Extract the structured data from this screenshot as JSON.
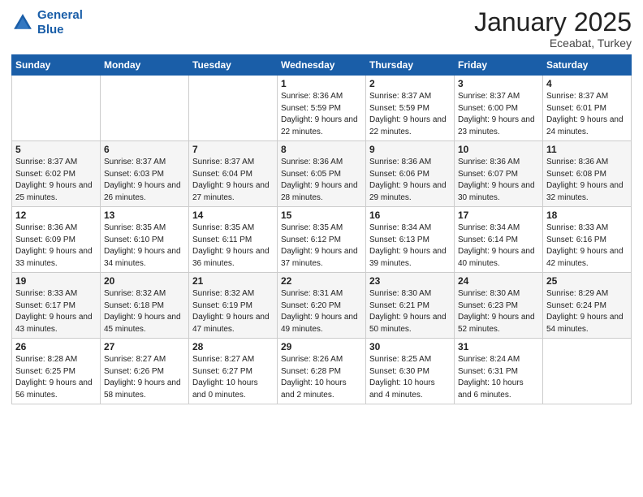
{
  "header": {
    "logo_line1": "General",
    "logo_line2": "Blue",
    "month": "January 2025",
    "location": "Eceabat, Turkey"
  },
  "weekdays": [
    "Sunday",
    "Monday",
    "Tuesday",
    "Wednesday",
    "Thursday",
    "Friday",
    "Saturday"
  ],
  "weeks": [
    [
      {
        "day": "",
        "info": ""
      },
      {
        "day": "",
        "info": ""
      },
      {
        "day": "",
        "info": ""
      },
      {
        "day": "1",
        "info": "Sunrise: 8:36 AM\nSunset: 5:59 PM\nDaylight: 9 hours and 22 minutes."
      },
      {
        "day": "2",
        "info": "Sunrise: 8:37 AM\nSunset: 5:59 PM\nDaylight: 9 hours and 22 minutes."
      },
      {
        "day": "3",
        "info": "Sunrise: 8:37 AM\nSunset: 6:00 PM\nDaylight: 9 hours and 23 minutes."
      },
      {
        "day": "4",
        "info": "Sunrise: 8:37 AM\nSunset: 6:01 PM\nDaylight: 9 hours and 24 minutes."
      }
    ],
    [
      {
        "day": "5",
        "info": "Sunrise: 8:37 AM\nSunset: 6:02 PM\nDaylight: 9 hours and 25 minutes."
      },
      {
        "day": "6",
        "info": "Sunrise: 8:37 AM\nSunset: 6:03 PM\nDaylight: 9 hours and 26 minutes."
      },
      {
        "day": "7",
        "info": "Sunrise: 8:37 AM\nSunset: 6:04 PM\nDaylight: 9 hours and 27 minutes."
      },
      {
        "day": "8",
        "info": "Sunrise: 8:36 AM\nSunset: 6:05 PM\nDaylight: 9 hours and 28 minutes."
      },
      {
        "day": "9",
        "info": "Sunrise: 8:36 AM\nSunset: 6:06 PM\nDaylight: 9 hours and 29 minutes."
      },
      {
        "day": "10",
        "info": "Sunrise: 8:36 AM\nSunset: 6:07 PM\nDaylight: 9 hours and 30 minutes."
      },
      {
        "day": "11",
        "info": "Sunrise: 8:36 AM\nSunset: 6:08 PM\nDaylight: 9 hours and 32 minutes."
      }
    ],
    [
      {
        "day": "12",
        "info": "Sunrise: 8:36 AM\nSunset: 6:09 PM\nDaylight: 9 hours and 33 minutes."
      },
      {
        "day": "13",
        "info": "Sunrise: 8:35 AM\nSunset: 6:10 PM\nDaylight: 9 hours and 34 minutes."
      },
      {
        "day": "14",
        "info": "Sunrise: 8:35 AM\nSunset: 6:11 PM\nDaylight: 9 hours and 36 minutes."
      },
      {
        "day": "15",
        "info": "Sunrise: 8:35 AM\nSunset: 6:12 PM\nDaylight: 9 hours and 37 minutes."
      },
      {
        "day": "16",
        "info": "Sunrise: 8:34 AM\nSunset: 6:13 PM\nDaylight: 9 hours and 39 minutes."
      },
      {
        "day": "17",
        "info": "Sunrise: 8:34 AM\nSunset: 6:14 PM\nDaylight: 9 hours and 40 minutes."
      },
      {
        "day": "18",
        "info": "Sunrise: 8:33 AM\nSunset: 6:16 PM\nDaylight: 9 hours and 42 minutes."
      }
    ],
    [
      {
        "day": "19",
        "info": "Sunrise: 8:33 AM\nSunset: 6:17 PM\nDaylight: 9 hours and 43 minutes."
      },
      {
        "day": "20",
        "info": "Sunrise: 8:32 AM\nSunset: 6:18 PM\nDaylight: 9 hours and 45 minutes."
      },
      {
        "day": "21",
        "info": "Sunrise: 8:32 AM\nSunset: 6:19 PM\nDaylight: 9 hours and 47 minutes."
      },
      {
        "day": "22",
        "info": "Sunrise: 8:31 AM\nSunset: 6:20 PM\nDaylight: 9 hours and 49 minutes."
      },
      {
        "day": "23",
        "info": "Sunrise: 8:30 AM\nSunset: 6:21 PM\nDaylight: 9 hours and 50 minutes."
      },
      {
        "day": "24",
        "info": "Sunrise: 8:30 AM\nSunset: 6:23 PM\nDaylight: 9 hours and 52 minutes."
      },
      {
        "day": "25",
        "info": "Sunrise: 8:29 AM\nSunset: 6:24 PM\nDaylight: 9 hours and 54 minutes."
      }
    ],
    [
      {
        "day": "26",
        "info": "Sunrise: 8:28 AM\nSunset: 6:25 PM\nDaylight: 9 hours and 56 minutes."
      },
      {
        "day": "27",
        "info": "Sunrise: 8:27 AM\nSunset: 6:26 PM\nDaylight: 9 hours and 58 minutes."
      },
      {
        "day": "28",
        "info": "Sunrise: 8:27 AM\nSunset: 6:27 PM\nDaylight: 10 hours and 0 minutes."
      },
      {
        "day": "29",
        "info": "Sunrise: 8:26 AM\nSunset: 6:28 PM\nDaylight: 10 hours and 2 minutes."
      },
      {
        "day": "30",
        "info": "Sunrise: 8:25 AM\nSunset: 6:30 PM\nDaylight: 10 hours and 4 minutes."
      },
      {
        "day": "31",
        "info": "Sunrise: 8:24 AM\nSunset: 6:31 PM\nDaylight: 10 hours and 6 minutes."
      },
      {
        "day": "",
        "info": ""
      }
    ]
  ]
}
